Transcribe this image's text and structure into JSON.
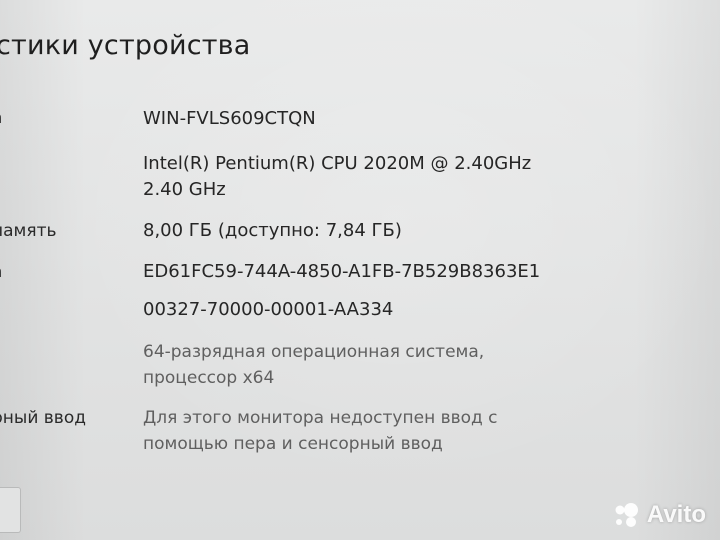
{
  "page": {
    "title": "стики устройства"
  },
  "specs": [
    {
      "label": "а",
      "value": "WIN-FVLS609CTQN"
    },
    {
      "label": "",
      "value_lines": [
        "Intel(R) Pentium(R) CPU 2020M @ 2.40GHz",
        "2.40 GHz"
      ]
    },
    {
      "label": "память",
      "value": "8,00 ГБ (доступно: 7,84 ГБ)"
    },
    {
      "label": "а",
      "value": "ED61FC59-744A-4850-A1FB-7B529B8363E1"
    },
    {
      "label": "",
      "value": "00327-70000-00001-AA334"
    },
    {
      "label": "",
      "value_lines": [
        "64-разрядная операционная система,",
        "процессор x64"
      ]
    },
    {
      "label": "рный ввод",
      "value_lines": [
        "Для этого монитора недоступен ввод с",
        "помощью пера и сенсорный ввод"
      ]
    }
  ],
  "watermark": {
    "text": "Avito",
    "icon": "avito-logo-icon"
  }
}
